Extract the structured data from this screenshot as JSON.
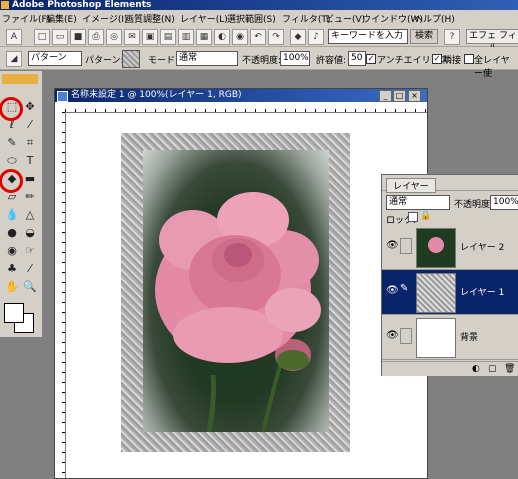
{
  "app": {
    "title": "Adobe Photoshop Elements"
  },
  "menu": [
    "ファイル(F)",
    "編集(E)",
    "イメージ(I)",
    "画質調整(N)",
    "レイヤー(L)",
    "選択範囲(S)",
    "フィルタ(T)",
    "ビュー(V)",
    "ウインドウ(W)",
    "ヘルプ(H)"
  ],
  "toolbar": {
    "search_placeholder": "キーワードを入力",
    "search_button": "検索",
    "tab_label": "エフェ フィル"
  },
  "options": {
    "fill_value": "パターン",
    "pattern_label": "パターン:",
    "mode_label": "モード:",
    "mode_value": "通常",
    "opacity_label": "不透明度:",
    "opacity_value": "100%",
    "tolerance_label": "許容値:",
    "tolerance_value": "50",
    "antialias_label": "アンチエイリアス",
    "contiguous_label": "隣接",
    "all_layers_label": "全レイヤー使"
  },
  "document": {
    "title": "名称未設定 1 @ 100%(レイヤー 1, RGB)"
  },
  "layers_palette": {
    "title": "レイヤー",
    "mode_value": "通常",
    "opacity_label": "不透明度:",
    "opacity_value": "100%",
    "lock_label": "ロック:",
    "layers": [
      {
        "name": "レイヤー 2",
        "selected": false
      },
      {
        "name": "レイヤー 1",
        "selected": true
      },
      {
        "name": "背景",
        "selected": false
      }
    ]
  },
  "colors": {
    "selection": "#0a246a",
    "highlight_circle": "#e00000"
  }
}
